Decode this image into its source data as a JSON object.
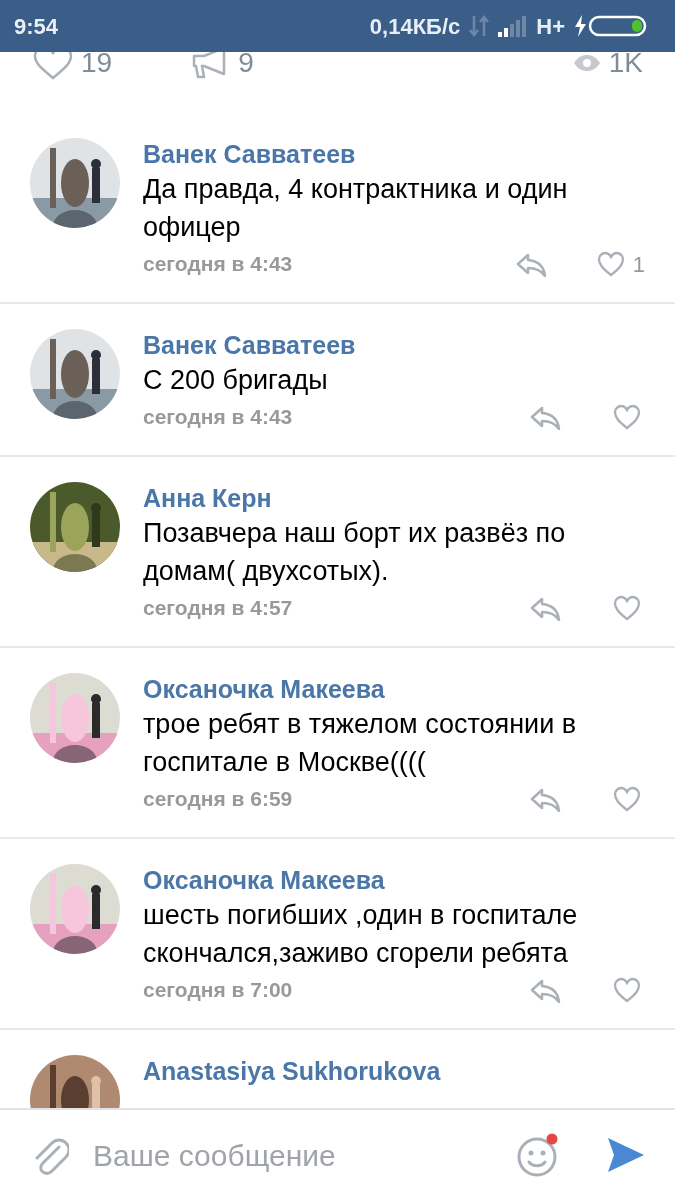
{
  "status_bar": {
    "time": "9:54",
    "speed": "0,14КБ/с",
    "network": "H+"
  },
  "stats": {
    "likes": "19",
    "reposts": "9",
    "views": "1K"
  },
  "comments": [
    {
      "author": "Ванек Савватеев",
      "text": "Да правда, 4 контрактника и один офицер",
      "time": "сегодня в 4:43",
      "like_count": "1"
    },
    {
      "author": "Ванек Савватеев",
      "text": "С 200 бригады",
      "time": "сегодня в 4:43"
    },
    {
      "author": "Анна Керн",
      "text": "Позавчера наш борт их развёз по домам( двухсотых).",
      "time": "сегодня в 4:57"
    },
    {
      "author": "Оксаночка Макеева",
      "text": "трое ребят в тяжелом состоянии в госпитале в Москве((((",
      "time": "сегодня в 6:59"
    },
    {
      "author": "Оксаночка Макеева",
      "text": "шесть погибших ,один в госпитале скончался,заживо сгорели ребята",
      "time": "сегодня в 7:00"
    },
    {
      "author": "Anastasiya Sukhorukova"
    }
  ],
  "composer": {
    "placeholder": "Ваше сообщение",
    "emoji_badge": true
  }
}
